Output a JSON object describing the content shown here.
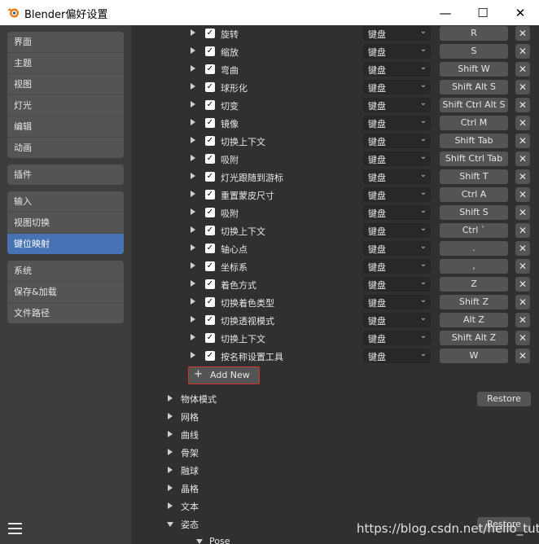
{
  "window": {
    "title": "Blender偏好设置",
    "controls": {
      "minimize": "—",
      "maximize": "☐",
      "close": "✕"
    }
  },
  "sidebar": {
    "groups": [
      {
        "items": [
          {
            "label": "界面",
            "active": false
          },
          {
            "label": "主题",
            "active": false
          },
          {
            "label": "视图",
            "active": false
          },
          {
            "label": "灯光",
            "active": false
          },
          {
            "label": "编辑",
            "active": false
          },
          {
            "label": "动画",
            "active": false
          }
        ]
      },
      {
        "items": [
          {
            "label": "插件",
            "active": false
          }
        ]
      },
      {
        "items": [
          {
            "label": "输入",
            "active": false
          },
          {
            "label": "视图切换",
            "active": false
          },
          {
            "label": "键位映射",
            "active": true
          }
        ]
      },
      {
        "items": [
          {
            "label": "系统",
            "active": false
          },
          {
            "label": "保存&加载",
            "active": false
          },
          {
            "label": "文件路径",
            "active": false
          }
        ]
      }
    ]
  },
  "keymap": {
    "items": [
      {
        "name": "旋转",
        "device": "键盘",
        "key": "R",
        "enabled": true
      },
      {
        "name": "缩放",
        "device": "键盘",
        "key": "S",
        "enabled": true
      },
      {
        "name": "弯曲",
        "device": "键盘",
        "key": "Shift W",
        "enabled": true
      },
      {
        "name": "球形化",
        "device": "键盘",
        "key": "Shift Alt S",
        "enabled": true
      },
      {
        "name": "切变",
        "device": "键盘",
        "key": "Shift Ctrl Alt S",
        "enabled": true
      },
      {
        "name": "镜像",
        "device": "键盘",
        "key": "Ctrl M",
        "enabled": true
      },
      {
        "name": "切换上下文",
        "device": "键盘",
        "key": "Shift Tab",
        "enabled": true
      },
      {
        "name": "吸附",
        "device": "键盘",
        "key": "Shift Ctrl Tab",
        "enabled": true
      },
      {
        "name": "灯光跟随到游标",
        "device": "键盘",
        "key": "Shift T",
        "enabled": true
      },
      {
        "name": "重置蒙皮尺寸",
        "device": "键盘",
        "key": "Ctrl A",
        "enabled": true
      },
      {
        "name": "吸附",
        "device": "键盘",
        "key": "Shift S",
        "enabled": true
      },
      {
        "name": "切换上下文",
        "device": "键盘",
        "key": "Ctrl `",
        "enabled": true
      },
      {
        "name": "轴心点",
        "device": "键盘",
        "key": ".",
        "enabled": true
      },
      {
        "name": "坐标系",
        "device": "键盘",
        "key": ",",
        "enabled": true
      },
      {
        "name": "着色方式",
        "device": "键盘",
        "key": "Z",
        "enabled": true
      },
      {
        "name": "切换着色类型",
        "device": "键盘",
        "key": "Shift Z",
        "enabled": true
      },
      {
        "name": "切换透视模式",
        "device": "键盘",
        "key": "Alt Z",
        "enabled": true
      },
      {
        "name": "切换上下文",
        "device": "键盘",
        "key": "Shift Alt Z",
        "enabled": true
      },
      {
        "name": "按名称设置工具",
        "device": "键盘",
        "key": "W",
        "enabled": true
      }
    ],
    "add_new_label": "Add New",
    "categories": [
      {
        "label": "物体模式",
        "expanded": false
      },
      {
        "label": "网格",
        "expanded": false
      },
      {
        "label": "曲线",
        "expanded": false
      },
      {
        "label": "骨架",
        "expanded": false
      },
      {
        "label": "融球",
        "expanded": false
      },
      {
        "label": "晶格",
        "expanded": false
      },
      {
        "label": "文本",
        "expanded": false
      },
      {
        "label": "姿态",
        "expanded": true
      }
    ],
    "restore_label": "Restore",
    "subcategory": "Pose (Global)"
  },
  "watermark": "https://blog.csdn.net/hello_tute"
}
